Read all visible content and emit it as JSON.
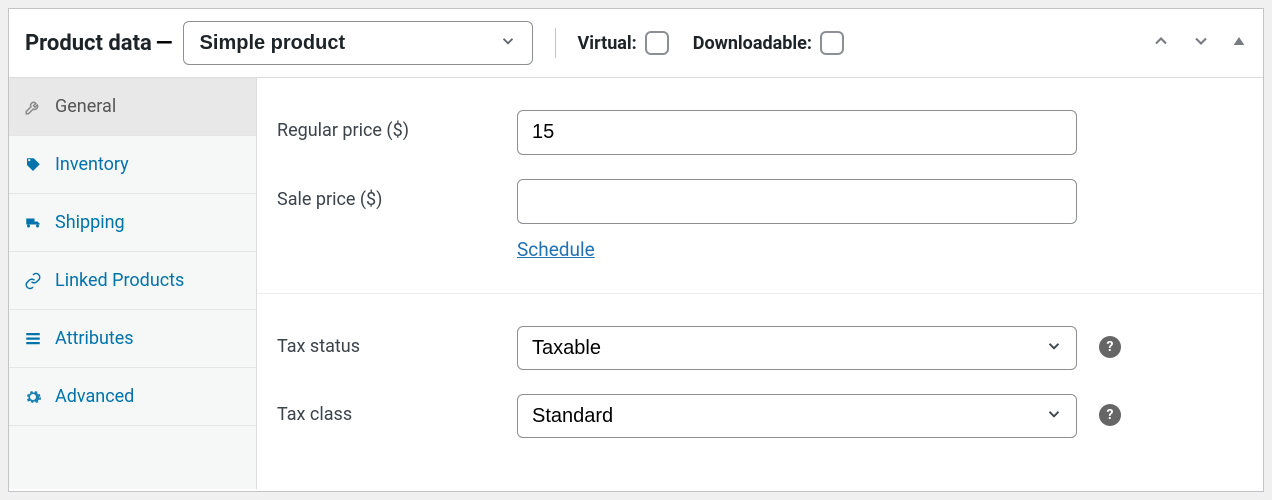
{
  "header": {
    "title": "Product data",
    "product_type": "Simple product",
    "virtual_label": "Virtual:",
    "downloadable_label": "Downloadable:"
  },
  "sidebar": {
    "items": [
      {
        "label": "General",
        "icon": "wrench",
        "active": true
      },
      {
        "label": "Inventory",
        "icon": "tag",
        "active": false
      },
      {
        "label": "Shipping",
        "icon": "truck",
        "active": false
      },
      {
        "label": "Linked Products",
        "icon": "link",
        "active": false
      },
      {
        "label": "Attributes",
        "icon": "list",
        "active": false
      },
      {
        "label": "Advanced",
        "icon": "gear",
        "active": false
      }
    ]
  },
  "form": {
    "regular_price_label": "Regular price ($)",
    "regular_price_value": "15",
    "sale_price_label": "Sale price ($)",
    "sale_price_value": "",
    "schedule_label": "Schedule",
    "tax_status_label": "Tax status",
    "tax_status_value": "Taxable",
    "tax_class_label": "Tax class",
    "tax_class_value": "Standard"
  }
}
